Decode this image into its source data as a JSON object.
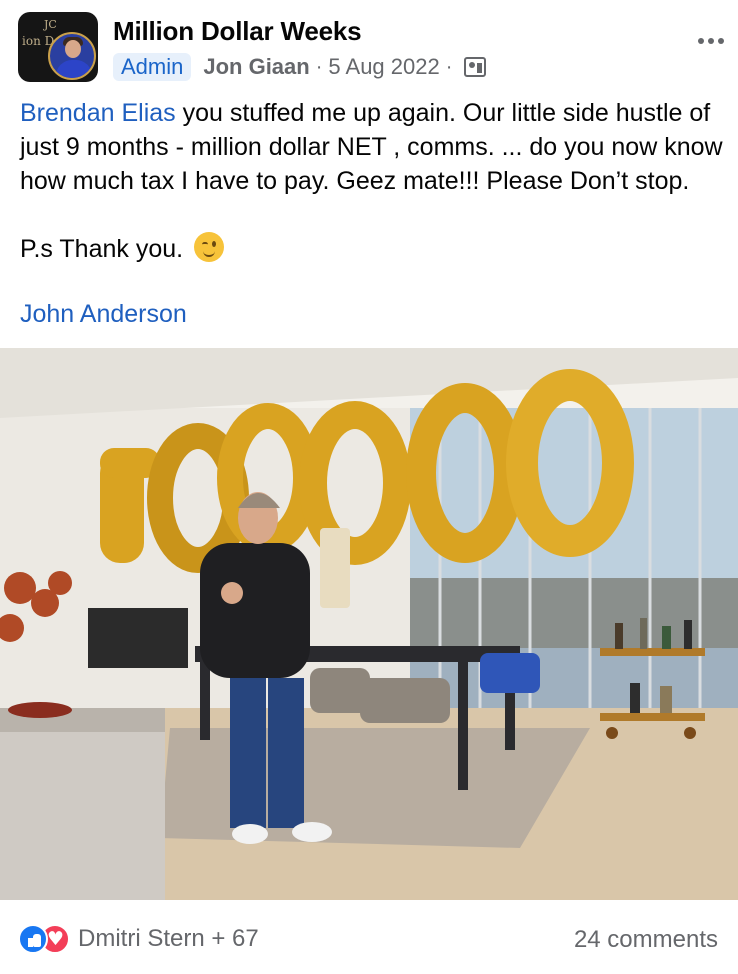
{
  "post": {
    "group_name": "Million Dollar Weeks",
    "avatar_logo_text": "ion D",
    "avatar_logo_mark": "JC",
    "role_badge": "Admin",
    "author": "Jon Giaan",
    "separator": "·",
    "date": "5 Aug 2022",
    "audience_icon": "group-icon",
    "more_icon": "more-horizontal-icon",
    "text": {
      "mention": "Brendan Elias",
      "line1_rest": " you stuffed me up again. Our little side hustle of just 9 months - million dollar NET , comms. ... do you now know how much tax I have to pay. Geez mate!!! Please Don’t stop.",
      "ps": "P.s Thank you.",
      "emoji": "winking-face-emoji",
      "tag": "John Anderson"
    },
    "photo": {
      "balloon_text": "100000",
      "balloon_color": "#d9a321"
    }
  },
  "footer": {
    "reactions": [
      "like",
      "love"
    ],
    "reaction_names": "Dmitri Stern + 67",
    "comments": "24 comments"
  },
  "colors": {
    "link": "#1f5fbf",
    "secondary_text": "#65676b",
    "like_blue": "#1877f2",
    "love_red": "#f33e58"
  }
}
